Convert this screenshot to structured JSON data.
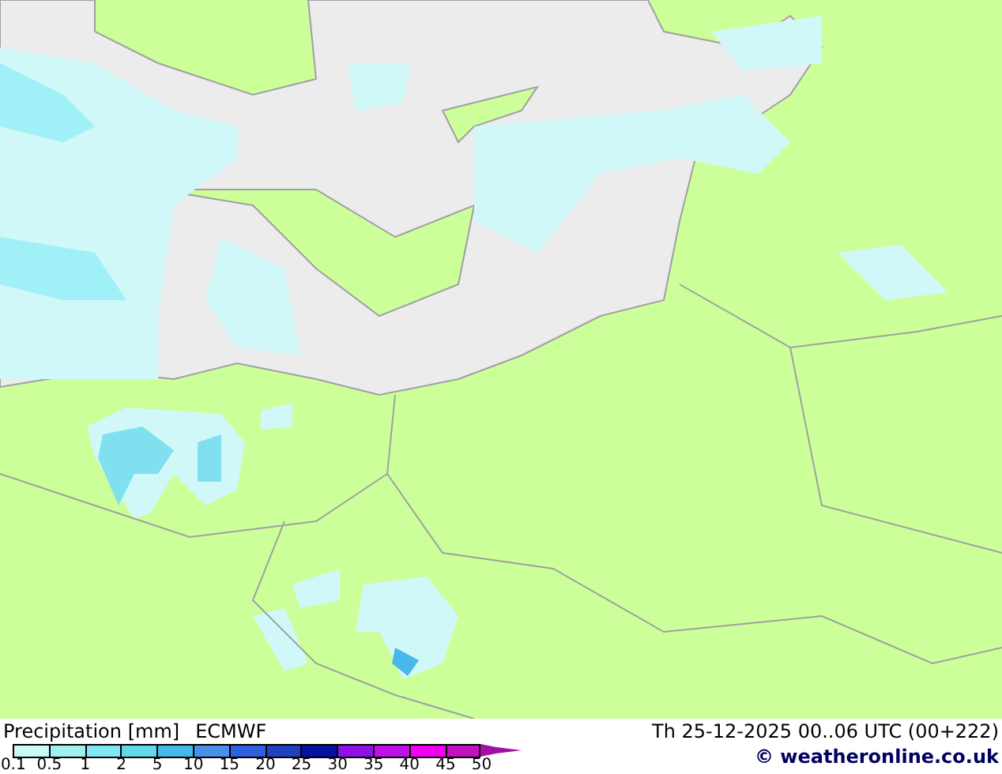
{
  "legend": {
    "title": "Precipitation [mm]",
    "model": "ECMWF",
    "bins": [
      {
        "label": "0.1",
        "color": "#c8f8f8"
      },
      {
        "label": "0.5",
        "color": "#a0f0f0"
      },
      {
        "label": "1",
        "color": "#80e8f0"
      },
      {
        "label": "2",
        "color": "#60d8e8"
      },
      {
        "label": "5",
        "color": "#48b8e8"
      },
      {
        "label": "10",
        "color": "#4890e8"
      },
      {
        "label": "15",
        "color": "#3060e0"
      },
      {
        "label": "20",
        "color": "#2040c0"
      },
      {
        "label": "25",
        "color": "#0810a0"
      },
      {
        "label": "30",
        "color": "#9010e8"
      },
      {
        "label": "35",
        "color": "#c010e8"
      },
      {
        "label": "40",
        "color": "#f000f0"
      },
      {
        "label": "45",
        "color": "#c010c0"
      }
    ],
    "end_label": "50",
    "overflow": {
      "color": "#a010a0"
    }
  },
  "valid_time": "Th 25-12-2025 00..06 UTC (00+222)",
  "copyright": "© weatheronline.co.uk"
}
